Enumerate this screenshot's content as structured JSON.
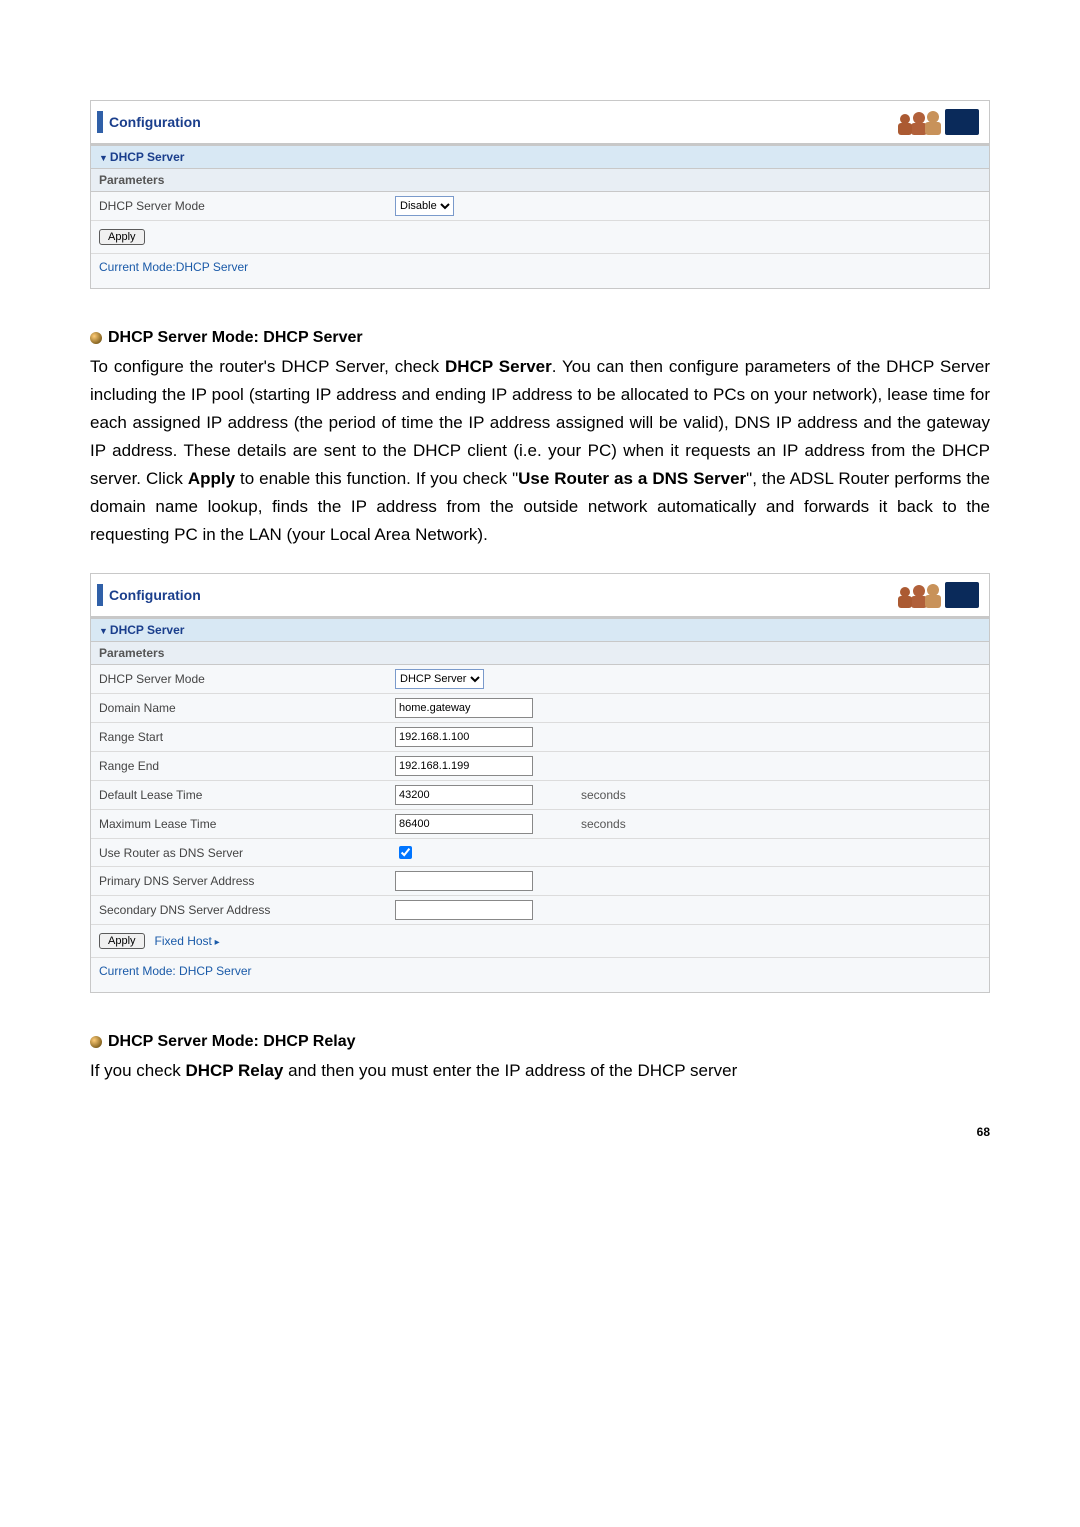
{
  "panel1": {
    "header": "Configuration",
    "section": "DHCP Server",
    "param_heading": "Parameters",
    "rows": {
      "mode_label": "DHCP Server Mode",
      "mode_value": "Disable"
    },
    "apply_label": "Apply",
    "status": "Current Mode:DHCP Server"
  },
  "doc1": {
    "heading": "DHCP Server Mode: DHCP Server",
    "p_before_bold1": "To configure the router's DHCP Server, check ",
    "b1": "DHCP Server",
    "p_mid1": ". You can then configure parameters of the DHCP Server including the IP pool (starting IP address and ending IP address to be allocated to PCs on your network), lease time for each assigned IP address (the period of time the IP address assigned will be valid), DNS IP address and the gateway IP address. These details are sent to the DHCP client (i.e. your PC) when it requests an IP address from the DHCP server. Click ",
    "b2": "Apply",
    "p_mid2": " to enable this function. If you check \"",
    "b3": "Use Router as a DNS Server",
    "p_after": "\", the ADSL Router performs the domain name lookup, finds the IP address from the outside network automatically and forwards it back to the requesting PC in the LAN (your Local Area Network)."
  },
  "panel2": {
    "header": "Configuration",
    "section": "DHCP Server",
    "param_heading": "Parameters",
    "labels": {
      "mode": "DHCP Server Mode",
      "domain": "Domain Name",
      "range_start": "Range Start",
      "range_end": "Range End",
      "default_lease": "Default Lease Time",
      "max_lease": "Maximum Lease Time",
      "use_router_dns": "Use Router as DNS Server",
      "primary_dns": "Primary DNS Server Address",
      "secondary_dns": "Secondary DNS Server Address"
    },
    "values": {
      "mode": "DHCP Server",
      "domain": "home.gateway",
      "range_start": "192.168.1.100",
      "range_end": "192.168.1.199",
      "default_lease": "43200",
      "max_lease": "86400",
      "primary_dns": "",
      "secondary_dns": ""
    },
    "units": {
      "seconds": "seconds"
    },
    "checkbox": {
      "use_router_dns": true
    },
    "apply_label": "Apply",
    "fixed_host_label": "Fixed Host",
    "status": "Current Mode: DHCP Server"
  },
  "doc2": {
    "heading": "DHCP Server Mode: DHCP Relay",
    "p_before": "If you check ",
    "b1": "DHCP Relay",
    "p_after": " and then you must enter the IP address of the DHCP server"
  },
  "page_number": "68"
}
